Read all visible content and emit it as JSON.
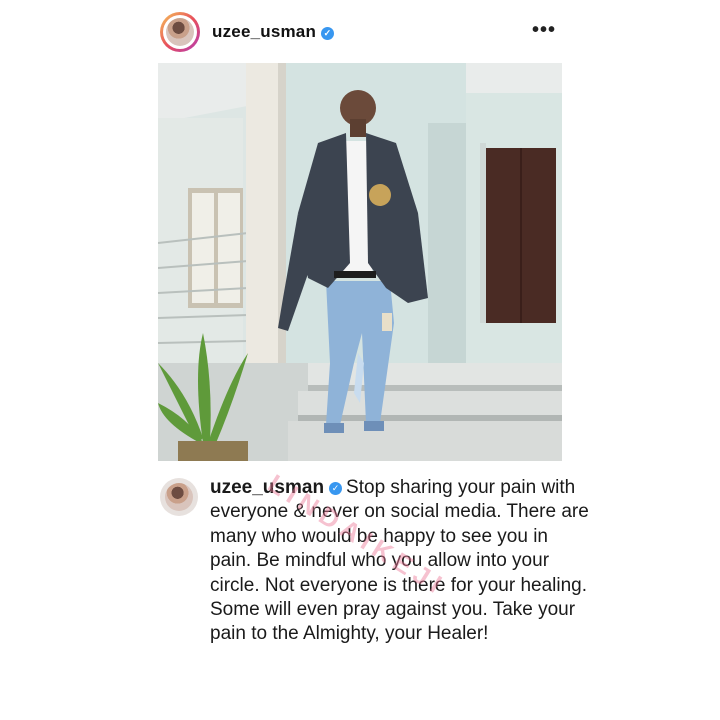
{
  "post": {
    "username": "uzee_usman",
    "verified_glyph": "✓",
    "more_glyph": "•••"
  },
  "caption": {
    "username": "uzee_usman",
    "text": "Stop sharing your pain with everyone & never on social media. There are many who would be happy to see you in pain. Be mindful who you allow into your circle. Not everyone is there for your healing. Some will even pray against you. Take your pain to the Almighty, your Healer!"
  },
  "watermark": "LINDAIKEJI",
  "colors": {
    "verified": "#3897f0",
    "avatar_ring_start": "#f6c75a",
    "avatar_ring_end": "#b33ab4",
    "watermark": "#ec7896"
  }
}
